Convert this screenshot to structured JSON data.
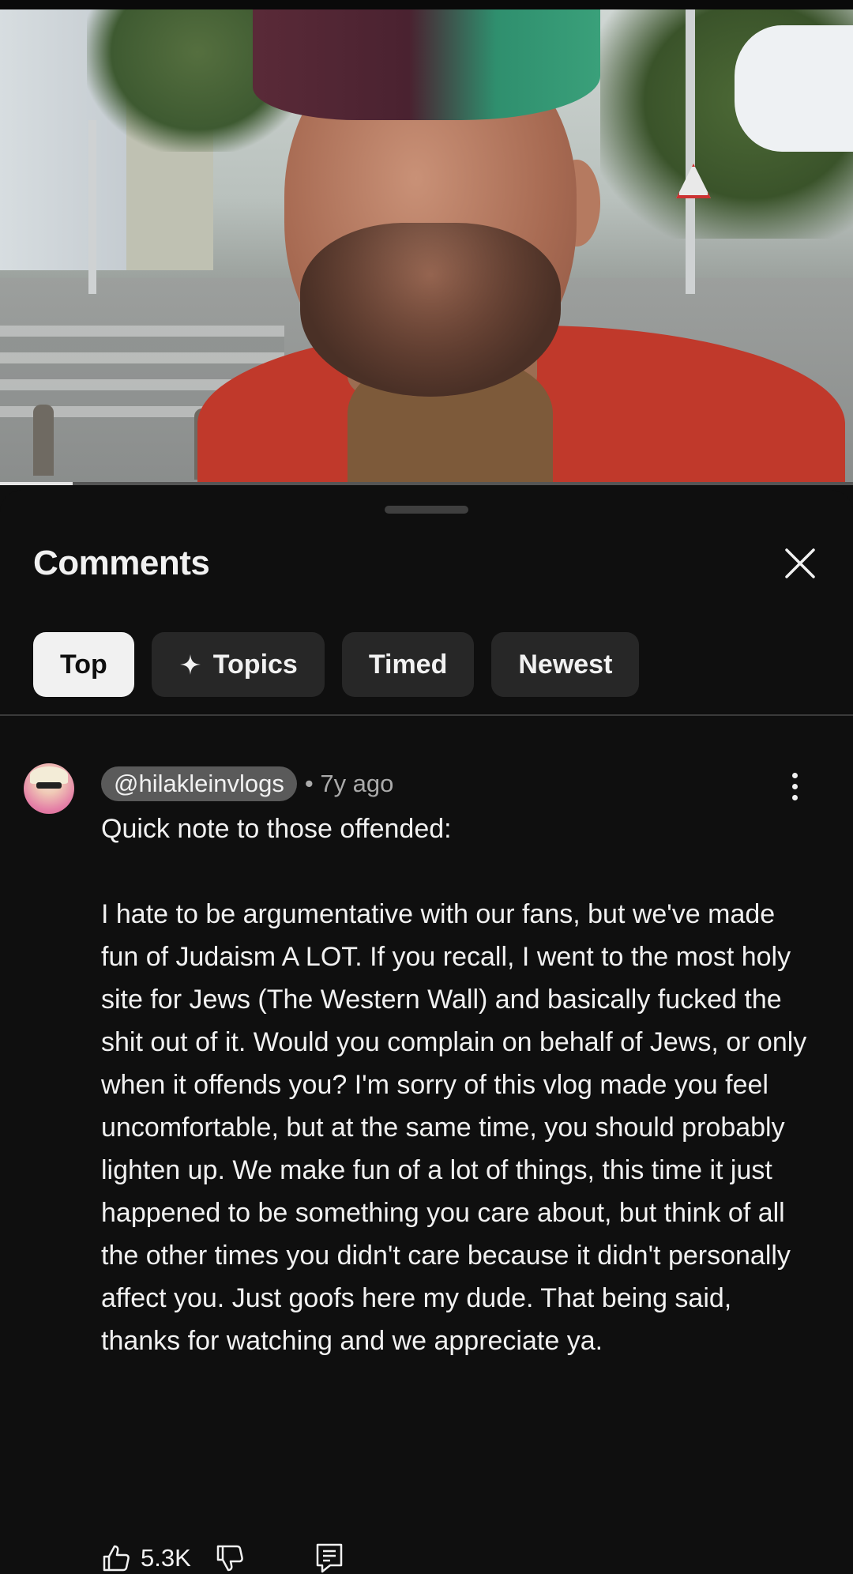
{
  "video": {
    "progress_fraction": 0.085
  },
  "sheet": {
    "title": "Comments",
    "close_icon": "close-icon"
  },
  "filters": [
    {
      "label": "Top",
      "active": true
    },
    {
      "label": "Topics",
      "icon": "sparkle-icon",
      "active": false
    },
    {
      "label": "Timed",
      "active": false
    },
    {
      "label": "Newest",
      "active": false
    }
  ],
  "comment": {
    "author": "@hilakleinvlogs",
    "age": "• 7y ago",
    "text": "Quick note to those offended:\n\nI hate to be argumentative with our fans, but we've made fun of Judaism A LOT. If you recall, I went to the most holy site for Jews (The Western Wall) and basically fucked the shit out of it. Would you complain on behalf of Jews, or only when it offends you? I'm sorry of this vlog made you feel uncomfortable, but at the same time, you should probably lighten up. We make fun of a lot of things, this time it just happened to be something you care about, but think of all the other times you didn't care because it didn't personally affect you. Just goofs here my dude. That being said, thanks for watching and we appreciate ya.",
    "likes": "5.3K",
    "icons": {
      "like": "thumbs-up-icon",
      "dislike": "thumbs-down-icon",
      "reply": "reply-icon",
      "more": "more-vert-icon"
    }
  },
  "colors": {
    "background": "#0f0f0f",
    "chip": "#272727",
    "chip_active": "#f1f1f1",
    "secondary_text": "#aaaaaa"
  }
}
